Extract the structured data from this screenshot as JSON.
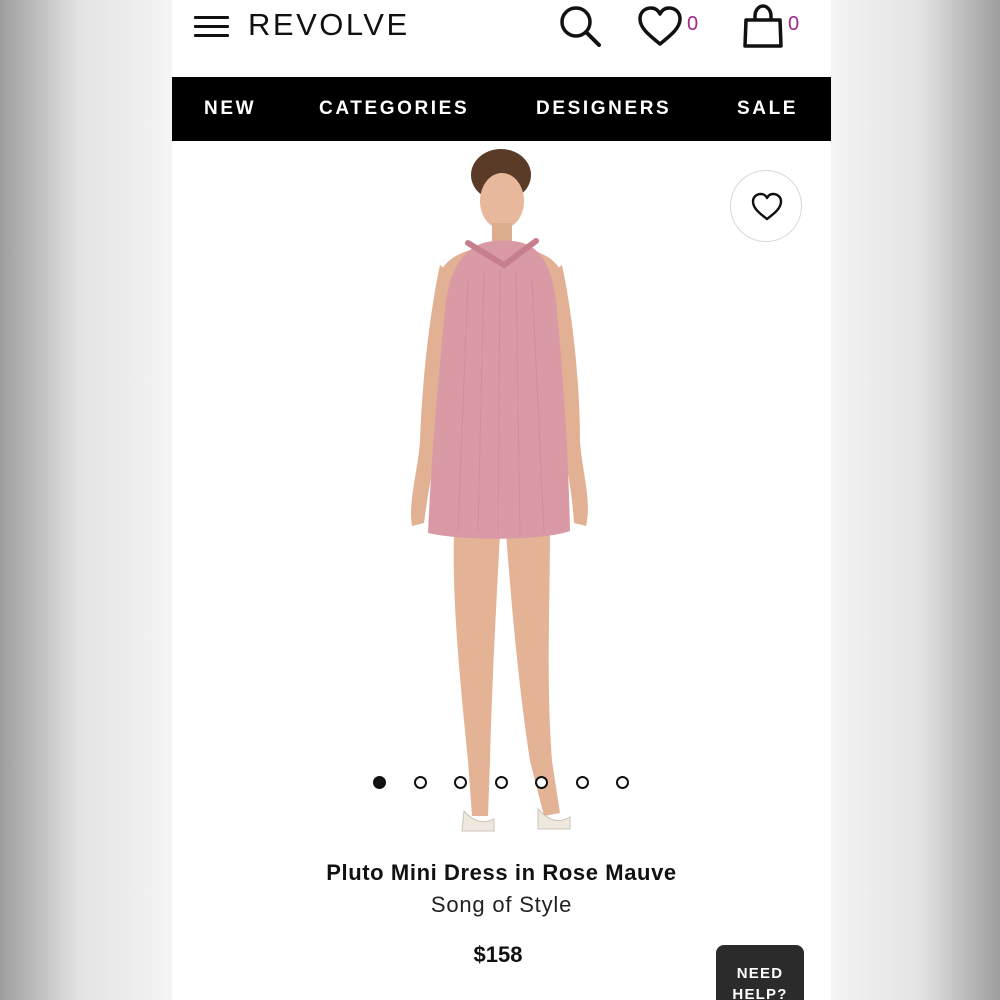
{
  "header": {
    "logo": "REVOLVE",
    "wishlist_count": "0",
    "bag_count": "0",
    "icons": [
      "menu-icon",
      "search-icon",
      "heart-icon",
      "bag-icon"
    ]
  },
  "nav": {
    "items": [
      "NEW",
      "CATEGORIES",
      "DESIGNERS",
      "SALE"
    ]
  },
  "product": {
    "title": "Pluto Mini Dress in Rose Mauve",
    "brand": "Song of Style",
    "price": "$158",
    "image_count": 7,
    "active_image": 1,
    "dress_color": "#d99aa6"
  },
  "help_button": {
    "label": "NEED HELP?"
  },
  "colors": {
    "accent": "#a3268b",
    "nav_bg": "#000000"
  }
}
